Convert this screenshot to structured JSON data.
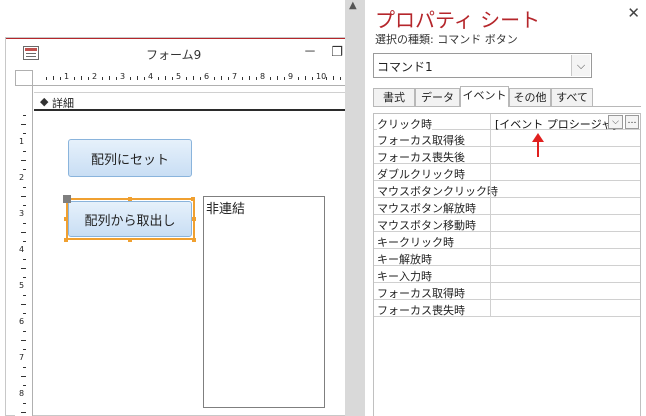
{
  "form_window": {
    "title": "フォーム9",
    "minimize_glyph": "－",
    "restore_glyph": "❐",
    "section_label": "詳細",
    "ruler_h_numbers": [
      "1",
      "2",
      "3",
      "4",
      "5",
      "6",
      "7",
      "8",
      "9",
      "10"
    ],
    "ruler_v_numbers": [
      "1",
      "2",
      "3",
      "4",
      "5",
      "6",
      "7",
      "8"
    ],
    "controls": {
      "button_set_label": "配列にセット",
      "button_get_label": "配列から取出し",
      "unbound_label": "非連結"
    }
  },
  "property_sheet": {
    "title": "プロパティ シート",
    "close_glyph": "✕",
    "selection_type": "選択の種類: コマンド ボタン",
    "object_select_value": "コマンド1",
    "tabs": [
      {
        "label": "書式",
        "active": false
      },
      {
        "label": "データ",
        "active": false
      },
      {
        "label": "イベント",
        "active": true
      },
      {
        "label": "その他",
        "active": false
      },
      {
        "label": "すべて",
        "active": false
      }
    ],
    "rows": [
      {
        "name": "クリック時",
        "value": "[イベント プロシージャ]"
      },
      {
        "name": "フォーカス取得後",
        "value": ""
      },
      {
        "name": "フォーカス喪失後",
        "value": ""
      },
      {
        "name": "ダブルクリック時",
        "value": ""
      },
      {
        "name": "マウスボタンクリック時",
        "value": ""
      },
      {
        "name": "マウスボタン解放時",
        "value": ""
      },
      {
        "name": "マウスボタン移動時",
        "value": ""
      },
      {
        "name": "キークリック時",
        "value": ""
      },
      {
        "name": "キー解放時",
        "value": ""
      },
      {
        "name": "キー入力時",
        "value": ""
      },
      {
        "name": "フォーカス取得時",
        "value": ""
      },
      {
        "name": "フォーカス喪失時",
        "value": ""
      }
    ],
    "dropdown_glyph": "⌵",
    "build_glyph": "…"
  },
  "colors": {
    "title_red": "#b5262b",
    "selection_orange": "#f0a030",
    "annotation_arrow": "#e0201f",
    "button_fill": "#c9def4"
  },
  "icons": {
    "form_icon": "form-icon",
    "section_arrow": "section-expand-icon",
    "annotation": "red-up-arrow-icon"
  }
}
